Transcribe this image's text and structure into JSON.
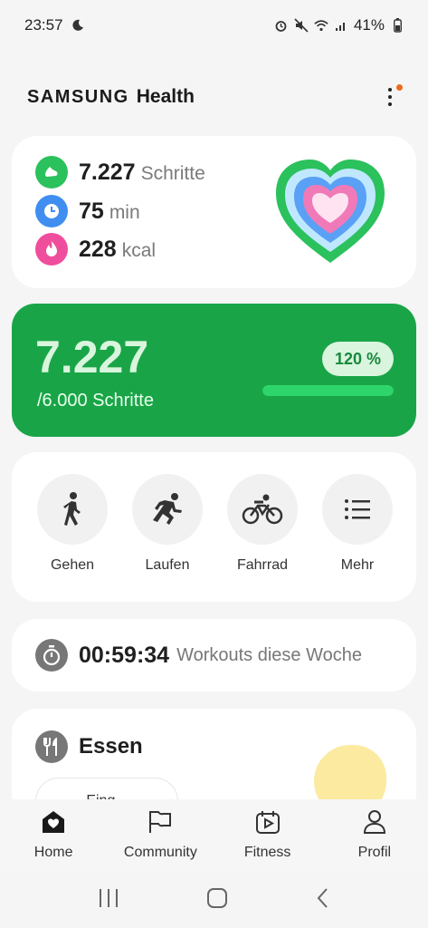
{
  "status": {
    "time": "23:57",
    "battery": "41%"
  },
  "app": {
    "brand_samsung": "SAMSUNG",
    "brand_health": "Health"
  },
  "summary": {
    "steps_value": "7.227",
    "steps_unit": "Schritte",
    "minutes_value": "75",
    "minutes_unit": "min",
    "kcal_value": "228",
    "kcal_unit": "kcal"
  },
  "steps": {
    "value": "7.227",
    "goal": "/6.000 Schritte",
    "percent": "120 %",
    "progress_fraction": 1.0
  },
  "activities": [
    {
      "label": "Gehen",
      "icon": "walking-icon"
    },
    {
      "label": "Laufen",
      "icon": "running-icon"
    },
    {
      "label": "Fahrrad",
      "icon": "bicycle-icon"
    },
    {
      "label": "Mehr",
      "icon": "list-icon"
    }
  ],
  "workout": {
    "time": "00:59:34",
    "label": "Workouts diese Woche"
  },
  "food": {
    "title": "Essen",
    "chip_label": "Eing..."
  },
  "nav": [
    {
      "label": "Home",
      "icon": "home-heart-icon"
    },
    {
      "label": "Community",
      "icon": "flag-icon"
    },
    {
      "label": "Fitness",
      "icon": "calendar-play-icon"
    },
    {
      "label": "Profil",
      "icon": "person-icon"
    }
  ],
  "colors": {
    "green_primary": "#19a547",
    "steps_icon": "#2bc15c",
    "minutes_icon": "#3f8ef0",
    "kcal_icon": "#ef4e9c",
    "notification_dot": "#ef6a1f"
  }
}
